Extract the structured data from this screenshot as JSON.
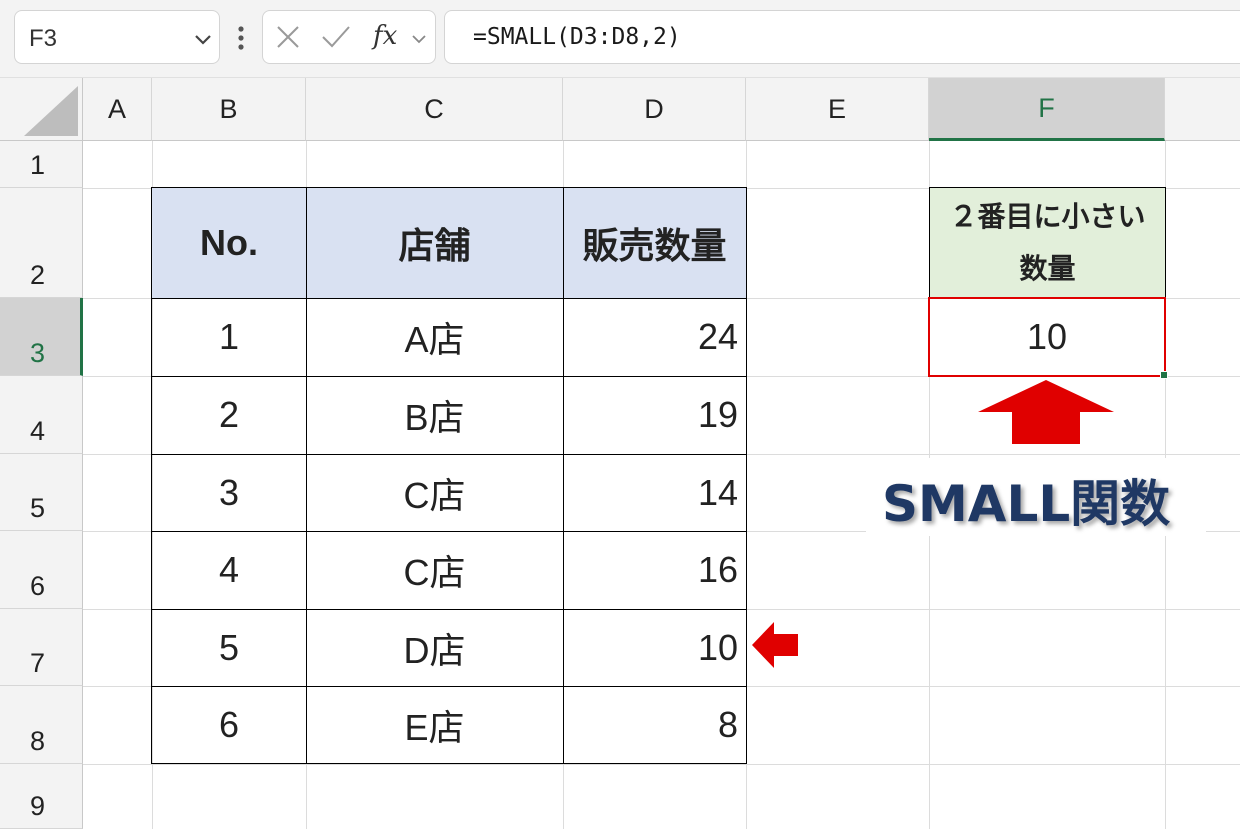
{
  "formula_bar": {
    "name_box": "F3",
    "fx_label": "fx",
    "formula": "=SMALL(D3:D8,2)"
  },
  "columns": [
    "A",
    "B",
    "C",
    "D",
    "E",
    "F"
  ],
  "rows": [
    "1",
    "2",
    "3",
    "4",
    "5",
    "6",
    "7",
    "8",
    "9"
  ],
  "table": {
    "headers": [
      "No.",
      "店舗",
      "販売数量"
    ],
    "rows": [
      [
        "1",
        "A店",
        "24"
      ],
      [
        "2",
        "B店",
        "19"
      ],
      [
        "3",
        "C店",
        "14"
      ],
      [
        "4",
        "C店",
        "16"
      ],
      [
        "5",
        "D店",
        "10"
      ],
      [
        "6",
        "E店",
        "8"
      ]
    ]
  },
  "result": {
    "header_line1": "２番目に小さい",
    "header_line2": "数量",
    "value": "10"
  },
  "callout_label": "SMALL関数",
  "colors": {
    "table_header_bg": "#d9e1f2",
    "result_header_bg": "#e2efda",
    "highlight_red": "#e00000",
    "excel_green": "#217346",
    "callout_text": "#1f3864"
  }
}
